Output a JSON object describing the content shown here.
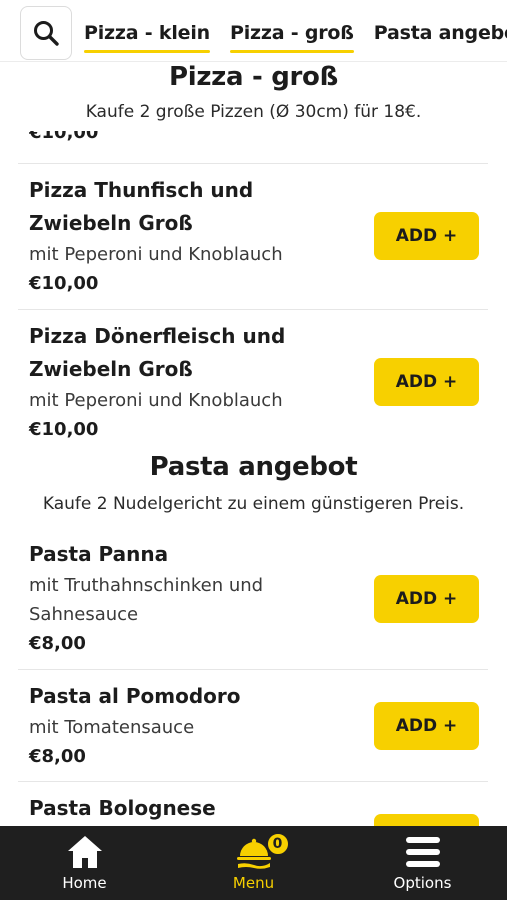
{
  "tabs": [
    {
      "label": "Pizza - klein",
      "active": true
    },
    {
      "label": "Pizza - groß",
      "active": true
    },
    {
      "label": "Pasta angebot",
      "active": false
    }
  ],
  "pizza_gross": {
    "title": "Pizza - groß",
    "subtitle": "Kaufe 2 große Pizzen (Ø 30cm) für 18€.",
    "cut_off_price": "€10,00",
    "items": [
      {
        "name": "Pizza Thunfisch und Zwiebeln Groß",
        "desc": "mit Peperoni und Knoblauch",
        "price": "€10,00",
        "button": "ADD +"
      },
      {
        "name": "Pizza Dönerfleisch und Zwiebeln Groß",
        "desc": "mit Peperoni und Knoblauch",
        "price": "€10,00",
        "button": "ADD +"
      }
    ]
  },
  "pasta": {
    "title": "Pasta angebot",
    "subtitle": "Kaufe 2 Nudelgericht zu einem günstigeren Preis.",
    "items": [
      {
        "name": "Pasta Panna",
        "desc": "mit Truthahnschinken und Sahnesauce",
        "price": "€8,00",
        "button": "ADD +"
      },
      {
        "name": "Pasta al Pomodoro",
        "desc": "mit Tomatensauce",
        "price": "€8,00",
        "button": "ADD +"
      },
      {
        "name": "Pasta Bolognese"
      }
    ]
  },
  "nav": {
    "home": "Home",
    "menu": "Menu",
    "options": "Options",
    "cart_count": "0"
  },
  "colors": {
    "accent": "#f7d000",
    "nav_bg": "#1f1f1f",
    "text": "#1c1c1c"
  },
  "icons": [
    "search-icon",
    "home-icon",
    "food-cover-icon",
    "hamburger-menu-icon"
  ]
}
